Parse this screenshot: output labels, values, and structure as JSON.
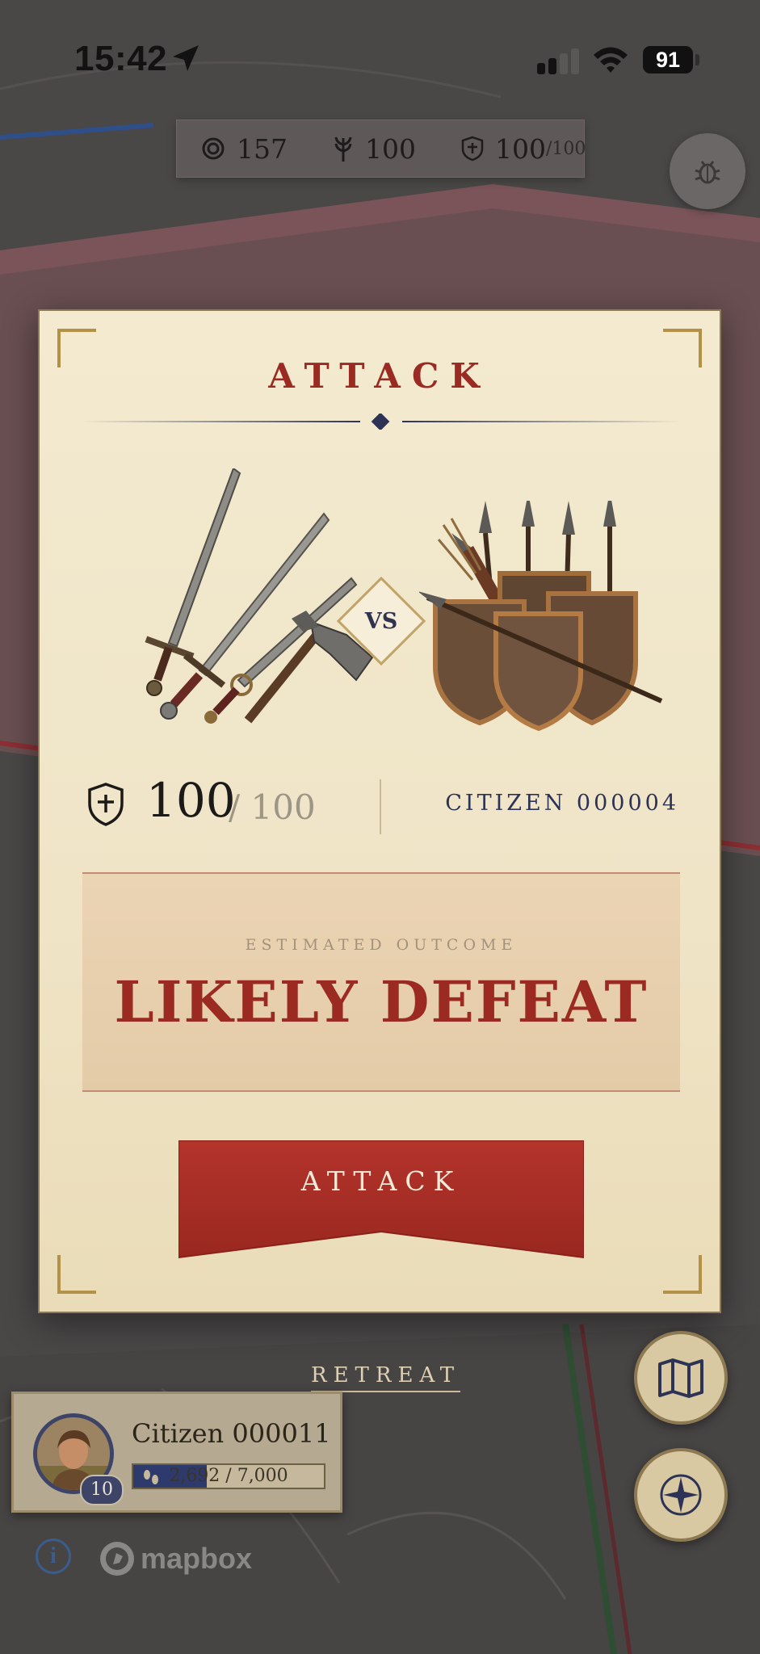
{
  "status_bar": {
    "time": "15:42",
    "battery": "91"
  },
  "resources": [
    {
      "icon": "gear-ring-icon",
      "value": "157",
      "max": ""
    },
    {
      "icon": "wheat-icon",
      "value": "100",
      "max": ""
    },
    {
      "icon": "shield-icon",
      "value": "100",
      "max": "/100"
    }
  ],
  "modal": {
    "title": "ATTACK",
    "vs_label": "VS",
    "defense": {
      "value": "100",
      "max": "/ 100"
    },
    "target_name": "CITIZEN 000004",
    "outcome_label": "ESTIMATED OUTCOME",
    "outcome_value": "LIKELY DEFEAT",
    "attack_button": "ATTACK"
  },
  "retreat_label": "RETREAT",
  "player": {
    "name": "Citizen 000011",
    "level": "10",
    "xp_text": "2,692 / 7,000",
    "xp_fraction": 0.3846
  },
  "mapbox": {
    "info": "i",
    "label": "mapbox"
  },
  "colors": {
    "accent": "#9b2a22",
    "navy": "#2d3354",
    "gold": "#b39248",
    "parchment": "#f3ead0"
  }
}
